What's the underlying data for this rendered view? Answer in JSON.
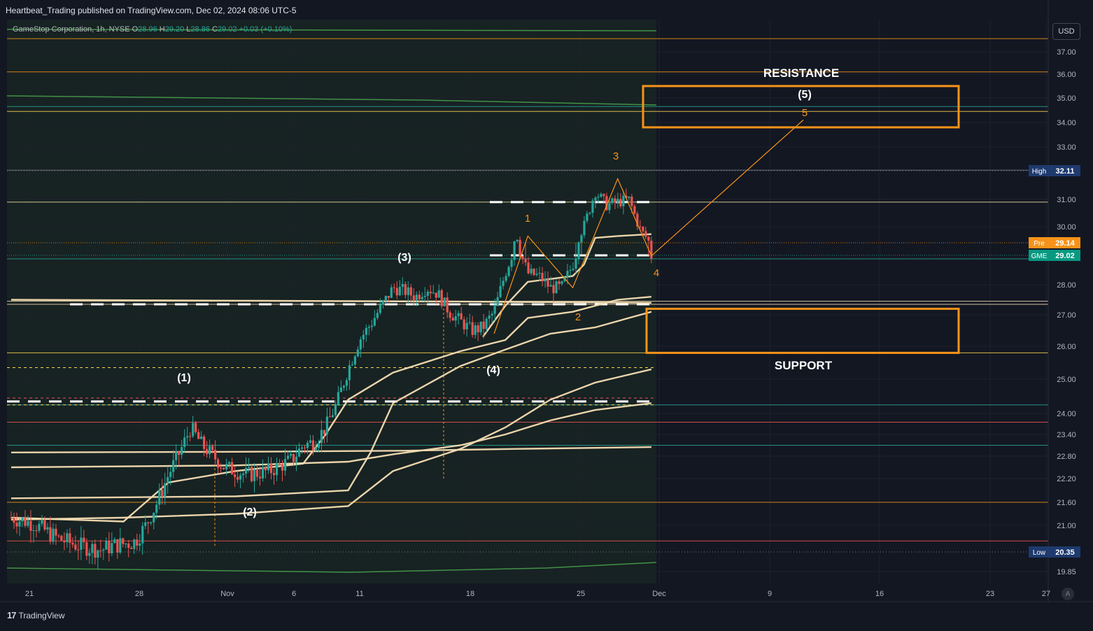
{
  "header": {
    "published_line": "Heartbeat_Trading published on TradingView.com, Dec 02, 2024 08:06 UTC-5",
    "symbol_line": "GameStop Corporation, 1h, NYSE",
    "ohlc": {
      "open_label": "O",
      "open": "28.96",
      "high_label": "H",
      "high": "29.20",
      "low_label": "L",
      "low": "28.86",
      "close_label": "C",
      "close": "29.02",
      "change": "+0.03 (+0.10%)"
    }
  },
  "currency_button": "USD",
  "footer": {
    "brand": "TradingView",
    "auto_button": "A"
  },
  "colors": {
    "background": "#131722",
    "up": "#26a69a",
    "down": "#ef5350",
    "orange": "#f7931a",
    "ema": "#f5deb3",
    "grid": "#1e222d"
  },
  "chart_data": {
    "type": "candlestick",
    "x_axis": {
      "tick_labels": [
        "21",
        "28",
        "Nov",
        "6",
        "11",
        "18",
        "25",
        "Dec",
        "9",
        "16",
        "23",
        "27"
      ]
    },
    "y_axis": {
      "range": [
        19.6,
        37.5
      ],
      "tick_labels": [
        "37.00",
        "36.00",
        "35.00",
        "34.00",
        "33.00",
        "31.00",
        "30.00",
        "28.00",
        "27.00",
        "26.00",
        "25.00",
        "24.00",
        "23.40",
        "22.80",
        "22.20",
        "21.60",
        "21.00",
        "19.85"
      ]
    },
    "price_badges": [
      {
        "label": "High",
        "value": "32.11",
        "price": 32.11,
        "color": "#1e3a6e"
      },
      {
        "label": "Pre",
        "value": "29.14",
        "price": 29.14,
        "color": "#f7931a"
      },
      {
        "label": "GME",
        "value": "29.02",
        "price": 29.02,
        "color": "#089981"
      },
      {
        "label": "Low",
        "value": "20.35",
        "price": 20.35,
        "color": "#1e3a6e"
      }
    ],
    "candle_path": [
      [
        0,
        21.2
      ],
      [
        2,
        21.05
      ],
      [
        4,
        20.7
      ],
      [
        6,
        20.5
      ],
      [
        8,
        20.4
      ],
      [
        9,
        20.5
      ],
      [
        11,
        20.6
      ],
      [
        12,
        21.0
      ],
      [
        13,
        21.6
      ],
      [
        14,
        22.3
      ],
      [
        15,
        22.9
      ],
      [
        16,
        23.6
      ],
      [
        17,
        23.1
      ],
      [
        18,
        22.8
      ],
      [
        19,
        22.5
      ],
      [
        21,
        22.3
      ],
      [
        23,
        22.4
      ],
      [
        25,
        22.7
      ],
      [
        26,
        23.1
      ],
      [
        27,
        23.2
      ],
      [
        28,
        23.6
      ],
      [
        29,
        24.3
      ],
      [
        30,
        25.3
      ],
      [
        31,
        26.2
      ],
      [
        32,
        26.7
      ],
      [
        33,
        27.3
      ],
      [
        34,
        27.9
      ],
      [
        35,
        27.8
      ],
      [
        36,
        27.6
      ],
      [
        37,
        27.9
      ],
      [
        38,
        27.7
      ],
      [
        39,
        27.1
      ],
      [
        40,
        26.8
      ],
      [
        41,
        26.5
      ],
      [
        42,
        26.6
      ],
      [
        43,
        27.1
      ],
      [
        44,
        28.4
      ],
      [
        45,
        29.5
      ],
      [
        46,
        28.4
      ],
      [
        47,
        28.3
      ],
      [
        48,
        27.9
      ],
      [
        49,
        27.9
      ],
      [
        50,
        28.7
      ],
      [
        51,
        30.0
      ],
      [
        52,
        31.3
      ],
      [
        53,
        30.8
      ],
      [
        54,
        30.9
      ],
      [
        55,
        31.0
      ],
      [
        56,
        29.9
      ],
      [
        57,
        29.0
      ]
    ],
    "horizontal_levels": [
      {
        "price": 37.55,
        "color": "#f7931a"
      },
      {
        "price": 36.1,
        "color": "#f7931a"
      },
      {
        "price": 34.45,
        "color": "#ffd54f"
      },
      {
        "price": 34.65,
        "color": "#26a69a"
      },
      {
        "price": 32.13,
        "color": "#787b86"
      },
      {
        "price": 30.9,
        "color": "#f5e6a8"
      },
      {
        "price": 28.9,
        "color": "#26a69a"
      },
      {
        "price": 27.45,
        "color": "#f5deb3"
      },
      {
        "price": 27.35,
        "color": "#f5deb3"
      },
      {
        "price": 25.8,
        "color": "#ffd54f"
      },
      {
        "price": 24.25,
        "color": "#26a69a"
      },
      {
        "price": 23.75,
        "color": "#ef5350"
      },
      {
        "price": 23.1,
        "color": "#26a69a"
      },
      {
        "price": 21.6,
        "color": "#f7931a"
      },
      {
        "price": 20.62,
        "color": "#ef5350"
      }
    ],
    "moving_averages": [
      {
        "color": "#f5deb3",
        "points": [
          [
            0,
            21.2
          ],
          [
            10,
            21.1
          ],
          [
            14,
            22.1
          ],
          [
            20,
            22.4
          ],
          [
            26,
            22.6
          ],
          [
            28,
            23.4
          ],
          [
            30,
            24.4
          ],
          [
            34,
            25.2
          ],
          [
            40,
            25.85
          ],
          [
            44,
            26.2
          ],
          [
            46,
            26.9
          ],
          [
            50,
            27.1
          ],
          [
            54,
            27.5
          ],
          [
            57,
            27.6
          ]
        ]
      },
      {
        "color": "#f5deb3",
        "points": [
          [
            0,
            21.7
          ],
          [
            20,
            21.75
          ],
          [
            30,
            21.9
          ],
          [
            32,
            22.9
          ],
          [
            34,
            24.3
          ],
          [
            40,
            25.4
          ],
          [
            44,
            25.9
          ],
          [
            48,
            26.4
          ],
          [
            52,
            26.6
          ],
          [
            55,
            26.9
          ],
          [
            57,
            27.1
          ]
        ]
      },
      {
        "color": "#f5deb3",
        "points": [
          [
            0,
            21.15
          ],
          [
            10,
            21.2
          ],
          [
            20,
            21.3
          ],
          [
            30,
            21.5
          ],
          [
            34,
            22.4
          ],
          [
            40,
            23.0
          ],
          [
            44,
            23.6
          ],
          [
            48,
            24.4
          ],
          [
            52,
            24.9
          ],
          [
            57,
            25.3
          ]
        ]
      },
      {
        "color": "#f5deb3",
        "points": [
          [
            0,
            22.5
          ],
          [
            20,
            22.55
          ],
          [
            30,
            22.65
          ],
          [
            34,
            22.85
          ],
          [
            40,
            23.1
          ],
          [
            44,
            23.4
          ],
          [
            48,
            23.8
          ],
          [
            52,
            24.1
          ],
          [
            57,
            24.3
          ]
        ]
      },
      {
        "color": "#f5deb3",
        "points": [
          [
            0,
            22.9
          ],
          [
            20,
            22.92
          ],
          [
            35,
            22.95
          ],
          [
            45,
            23.0
          ],
          [
            57,
            23.05
          ]
        ]
      },
      {
        "color": "#f5deb3",
        "points": [
          [
            0,
            27.5
          ],
          [
            20,
            27.47
          ],
          [
            40,
            27.44
          ],
          [
            57,
            27.4
          ]
        ]
      },
      {
        "color": "#f5deb3",
        "points": [
          [
            42,
            26.3
          ],
          [
            44,
            27.3
          ],
          [
            46,
            28.1
          ],
          [
            48,
            28.2
          ],
          [
            50,
            28.3
          ],
          [
            51,
            28.7
          ],
          [
            52,
            29.4
          ],
          [
            54,
            29.5
          ],
          [
            57,
            29.6
          ]
        ]
      }
    ],
    "elliott_waves": {
      "primary_labels": [
        "(1)",
        "(2)",
        "(3)",
        "(4)",
        "(5)"
      ],
      "minor_labels": [
        "1",
        "2",
        "3",
        "4",
        "5"
      ],
      "minor_path": [
        [
          43,
          26.4
        ],
        [
          46,
          29.5
        ],
        [
          50,
          27.9
        ],
        [
          54,
          31.8
        ],
        [
          57,
          29.0
        ],
        [
          71,
          34.1
        ]
      ]
    },
    "zones": {
      "resistance": {
        "label": "RESISTANCE",
        "price_top": 35.5,
        "price_bottom": 33.8
      },
      "support": {
        "label": "SUPPORT",
        "price_top": 27.2,
        "price_bottom": 25.8
      }
    }
  }
}
